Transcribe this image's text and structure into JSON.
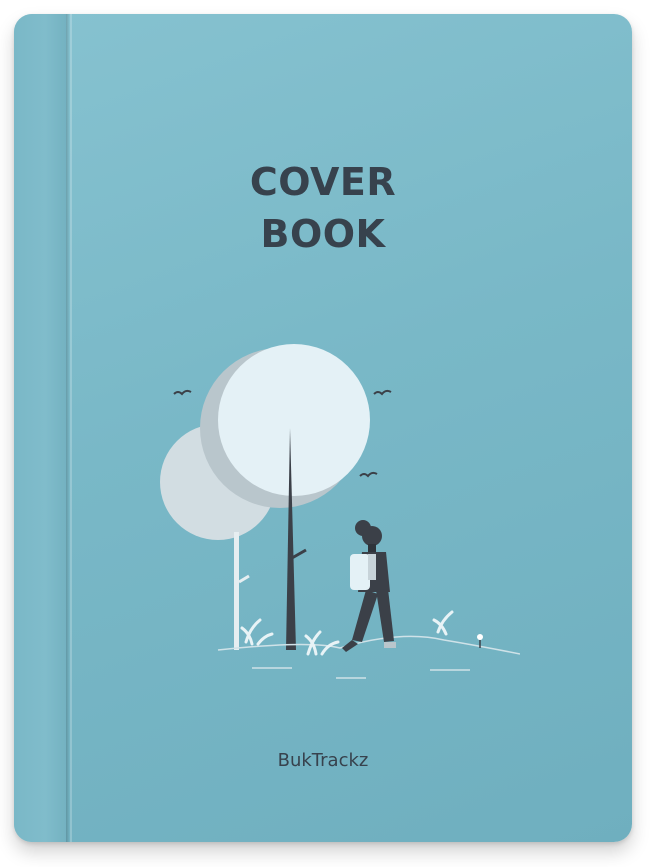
{
  "cover": {
    "title_line1": "COVER",
    "title_line2": "BOOK",
    "author": "BukTrackz"
  },
  "colors": {
    "cover": "#79b8c7",
    "text": "#37424d",
    "tree_light": "#e4f1f6",
    "tree_shadow": "#b9c8d0",
    "dark": "#3b4048"
  },
  "illustration": {
    "icon": "hiker-with-trees-illustration"
  }
}
